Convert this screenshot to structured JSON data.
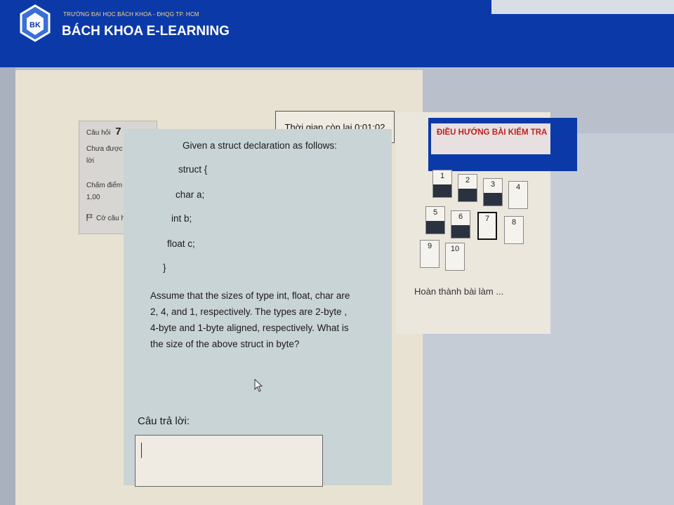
{
  "header": {
    "university": "TRƯỜNG ĐẠI HỌC BÁCH KHOA - ĐHQG TP. HCM",
    "site_title": "BÁCH KHOA E-LEARNING",
    "logo_text": "BK"
  },
  "question_info": {
    "label": "Câu hỏi",
    "number": "7",
    "status_line1": "Chưa được trả",
    "status_line2": "lời",
    "grade_line1": "Chấm điểm của",
    "grade_line2": "1,00",
    "flag_label": "Cờ câu hỏi"
  },
  "timer": {
    "text": "Thời gian còn lại 0:01:02"
  },
  "question": {
    "intro": "Given a struct declaration as follows:",
    "code": [
      "struct {",
      "char a;",
      "int b;",
      "float c;",
      "}"
    ],
    "paragraph": "Assume that the sizes of type int, float, char are 2, 4, and 1, respectively. The types are 2-byte , 4-byte and 1-byte aligned, respectively. What is the size of the above struct in byte?"
  },
  "answer": {
    "label": "Câu trả lời:",
    "value": ""
  },
  "navigation": {
    "title": "ĐIỀU HƯỚNG BÀI KIỂM TRA",
    "questions": [
      {
        "num": "1",
        "answered": true
      },
      {
        "num": "2",
        "answered": true
      },
      {
        "num": "3",
        "answered": true
      },
      {
        "num": "4",
        "answered": false
      },
      {
        "num": "5",
        "answered": true
      },
      {
        "num": "6",
        "answered": true
      },
      {
        "num": "7",
        "answered": false,
        "current": true
      },
      {
        "num": "8",
        "answered": false
      },
      {
        "num": "9",
        "answered": false
      },
      {
        "num": "10",
        "answered": false
      }
    ],
    "finish_link": "Hoàn thành bài làm ..."
  },
  "colors": {
    "header_blue": "#0b3aa8",
    "nav_title_red": "#c02020",
    "answered_fill": "#2a3240"
  }
}
